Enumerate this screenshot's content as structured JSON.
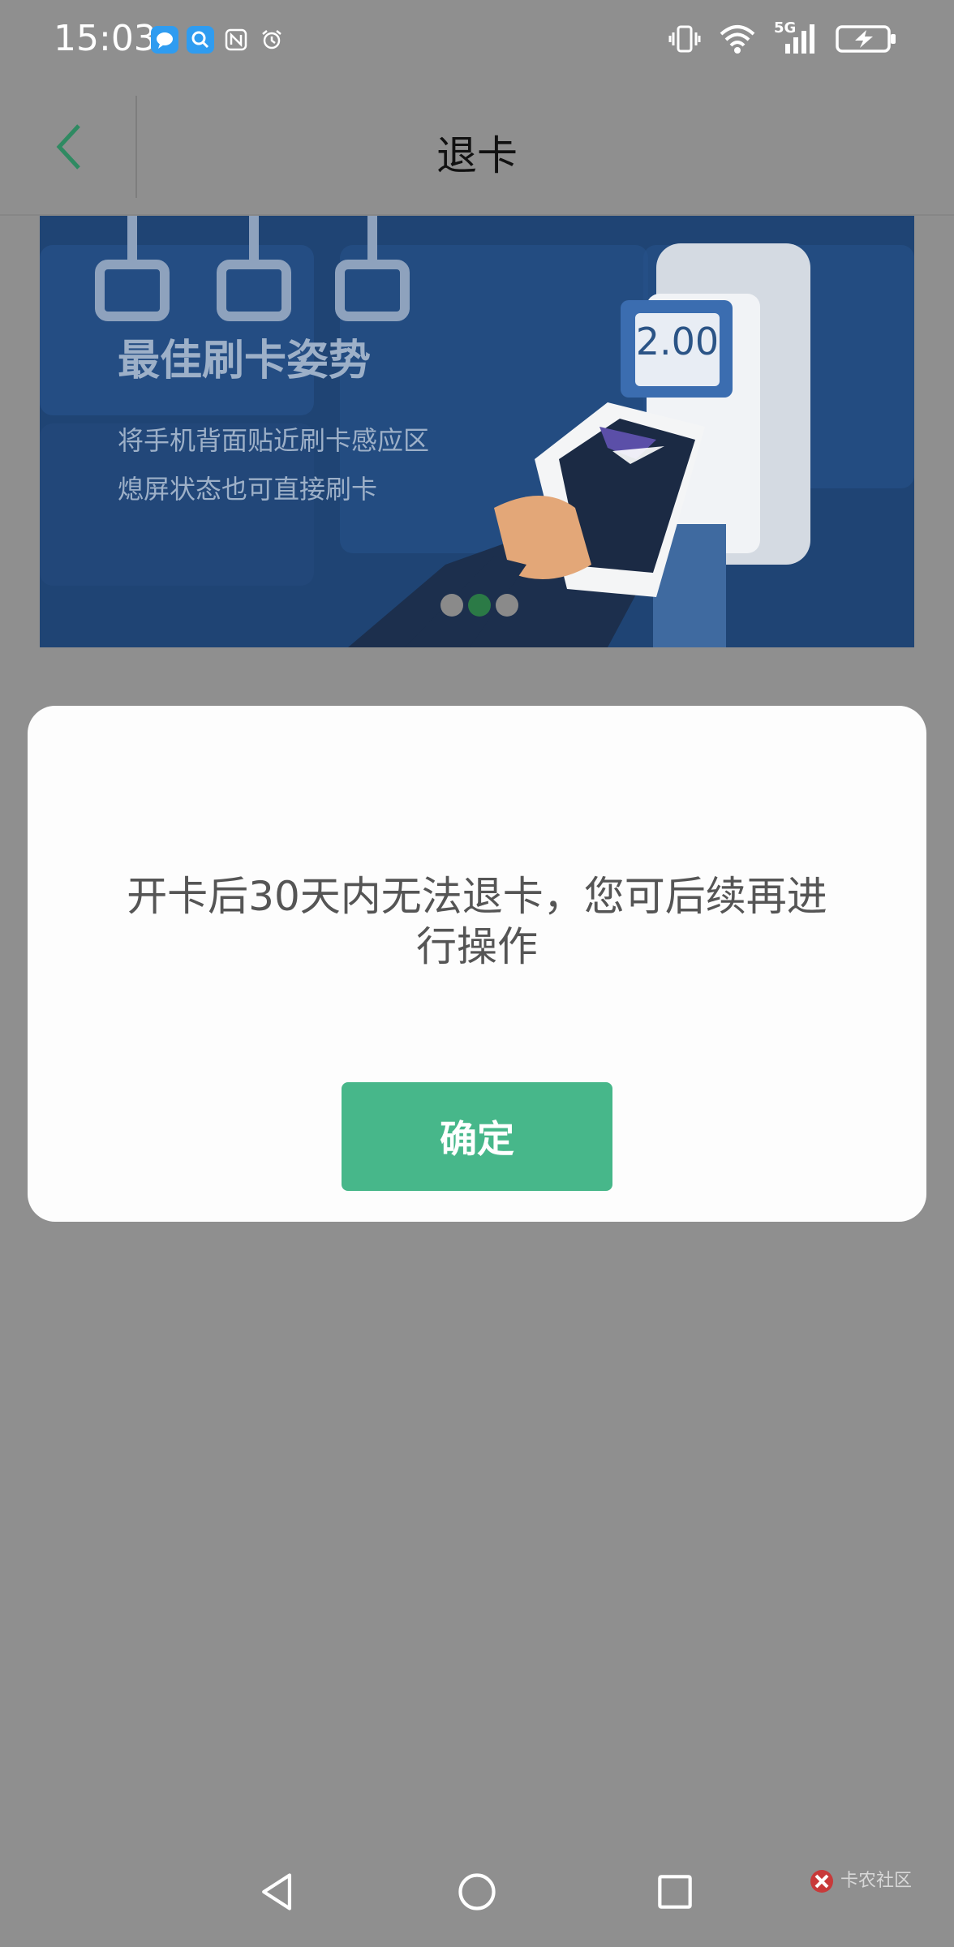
{
  "status_bar": {
    "time": "15:03",
    "left_icons": [
      "chat-icon",
      "search-icon",
      "nfc-icon",
      "alarm-icon"
    ],
    "right_icons": [
      "vibrate-icon",
      "wifi-icon",
      "signal-5g-icon",
      "battery-charging-icon"
    ],
    "network": "5G"
  },
  "header": {
    "title": "退卡",
    "back_icon": "chevron-left-icon",
    "accent": "#2f8a62"
  },
  "banner": {
    "title": "最佳刷卡姿势",
    "line1": "将手机背面贴近刷卡感应区",
    "line2": "熄屏状态也可直接刷卡",
    "fare_display": "2.00",
    "pager": {
      "count": 3,
      "active_index": 1
    }
  },
  "dialog": {
    "message": "开卡后30天内无法退卡，您可后续再进行操作",
    "confirm_label": "确定",
    "confirm_color": "#47b78a"
  },
  "nav_bar": {
    "icons": [
      "back-triangle-icon",
      "home-circle-icon",
      "recent-square-icon"
    ],
    "watermark": "卡农社区"
  }
}
